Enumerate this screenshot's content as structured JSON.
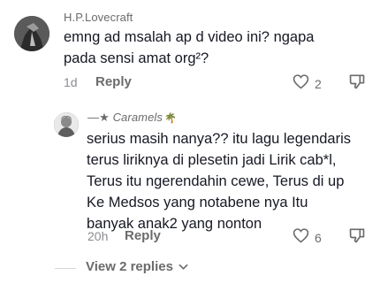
{
  "comment": {
    "username": "H.P.Lovecraft",
    "text_line1": "emng ad msalah ap d video ini? ngapa",
    "text_line2": "pada sensi amat org²?",
    "time": "1d",
    "reply_label": "Reply",
    "like_count": "2"
  },
  "reply_comment": {
    "username": "—★ Caramels",
    "username_emoji": "🌴",
    "lines": [
      "serius masih nanya?? itu lagu legendaris",
      "terus liriknya di plesetin jadi Lirik cab*l,",
      "Terus itu ngerendahin cewe, Terus di up",
      "Ke Medsos yang notabene nya Itu",
      "banyak anak2 yang nonton"
    ],
    "time": "20h",
    "reply_label": "Reply",
    "like_count": "6"
  },
  "view_replies": {
    "label": "View 2 replies"
  },
  "icons": {
    "like": "heart-icon",
    "dislike": "thumbs-down-icon",
    "expand": "chevron-down-icon"
  }
}
